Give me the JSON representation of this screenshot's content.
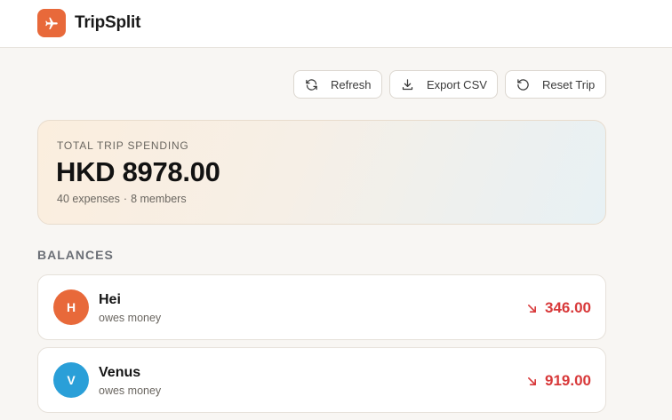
{
  "app": {
    "name": "TripSplit",
    "accent_color": "#e8693a",
    "logo_icon": "plane-icon"
  },
  "toolbar": {
    "refresh": {
      "label": "Refresh",
      "icon": "refresh-icon"
    },
    "export": {
      "label": "Export CSV",
      "icon": "download-icon"
    },
    "reset": {
      "label": "Reset Trip",
      "icon": "reset-icon"
    }
  },
  "summary": {
    "label": "TOTAL TRIP SPENDING",
    "total": "HKD 8978.00",
    "expenses": "40 expenses",
    "separator": "·",
    "members": "8 members"
  },
  "balances": {
    "heading": "BALANCES",
    "items": [
      {
        "initial": "H",
        "name": "Hei",
        "status": "owes money",
        "amount": "346.00",
        "avatar_color": "#e8693a",
        "trend_icon": "arrow-down-right-icon"
      },
      {
        "initial": "V",
        "name": "Venus",
        "status": "owes money",
        "amount": "919.00",
        "avatar_color": "#2a9fd8",
        "trend_icon": "arrow-down-right-icon"
      }
    ],
    "negative_color": "#d8393a"
  }
}
